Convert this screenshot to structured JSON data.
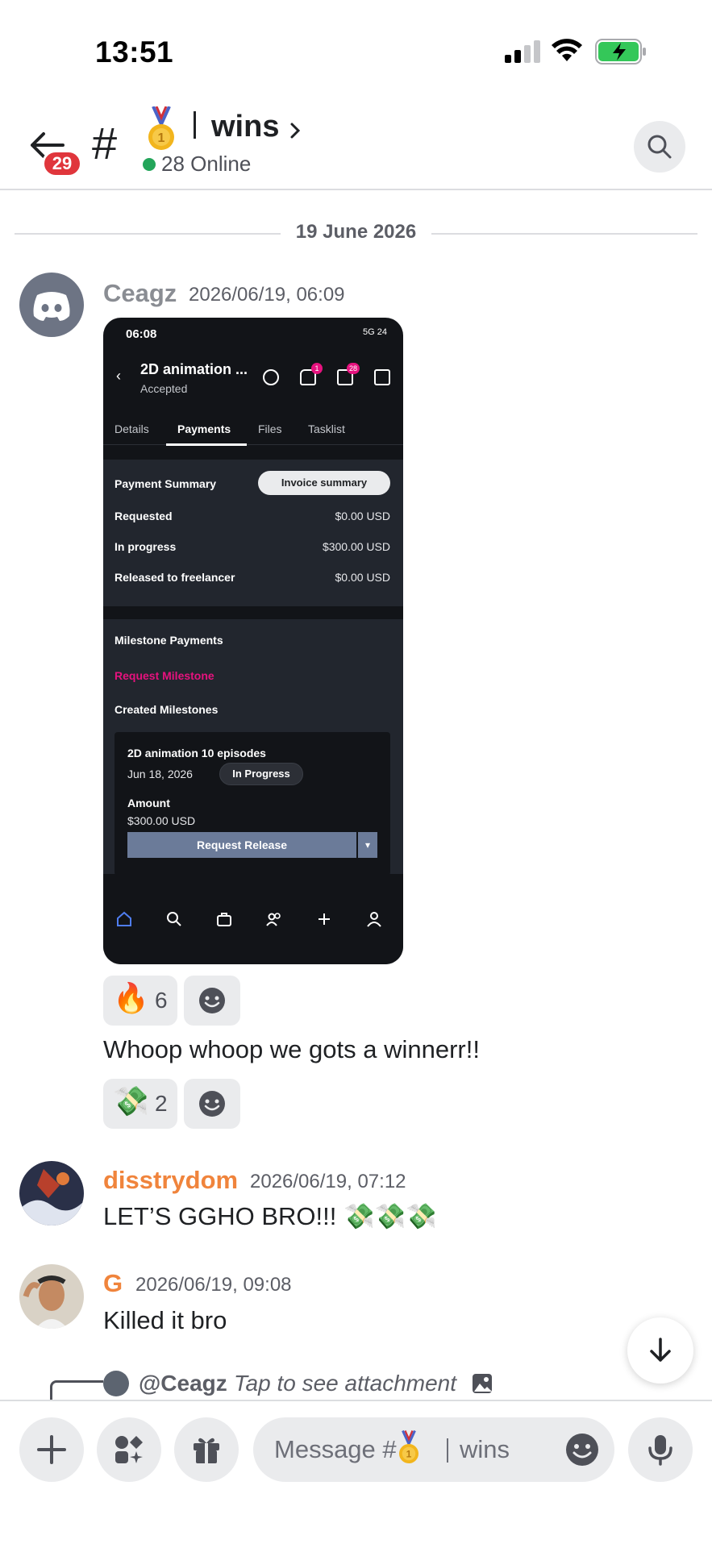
{
  "status_bar": {
    "time": "13:51"
  },
  "header": {
    "unread_count": "29",
    "hash": "#",
    "channel_name": "wins",
    "online": "28 Online"
  },
  "date_divider": "19 June 2026",
  "messages": [
    {
      "username": "Ceagz",
      "username_color": "#8a8d93",
      "timestamp": "2026/06/19, 06:09",
      "text": "Whoop whoop we gots a winnerr!!",
      "reactions_top": [
        {
          "emoji": "🔥",
          "count": "6"
        }
      ],
      "reactions_bottom": [
        {
          "emoji": "💸",
          "count": "2"
        }
      ]
    },
    {
      "username": "disstrydom",
      "username_color": "#f0843c",
      "timestamp": "2026/06/19, 07:12",
      "text": "LET’S GGHO BRO!!! 💸💸💸"
    },
    {
      "username": "G",
      "username_color": "#f0843c",
      "timestamp": "2026/06/19, 09:08",
      "text": "Killed it bro"
    }
  ],
  "attachment": {
    "status_time": "06:08",
    "status_right": "5G 24",
    "title": "2D animation ...",
    "subtitle": "Accepted",
    "badge_bell": "1",
    "badge_folder": "28",
    "tabs": [
      "Details",
      "Payments",
      "Files",
      "Tasklist"
    ],
    "payment_summary": "Payment Summary",
    "invoice_summary": "Invoice summary",
    "rows": [
      {
        "label": "Requested",
        "value": "$0.00 USD"
      },
      {
        "label": "In progress",
        "value": "$300.00 USD"
      },
      {
        "label": "Released to freelancer",
        "value": "$0.00 USD"
      }
    ],
    "milestone_payments": "Milestone Payments",
    "request_milestone": "Request Milestone",
    "created_milestones": "Created Milestones",
    "milestone": {
      "title": "2D animation 10 episodes",
      "date": "Jun 18, 2026",
      "status": "In Progress",
      "amount_label": "Amount",
      "amount": "$300.00 USD",
      "button": "Request Release"
    }
  },
  "reply": {
    "mention": "@Ceagz",
    "text": "Tap to see attachment"
  },
  "composer": {
    "placeholder": "Message #",
    "channel": "wins"
  },
  "colors": {
    "accent_pink": "#e6127e",
    "badge_red": "#e0363c",
    "online_green": "#23a55a"
  }
}
